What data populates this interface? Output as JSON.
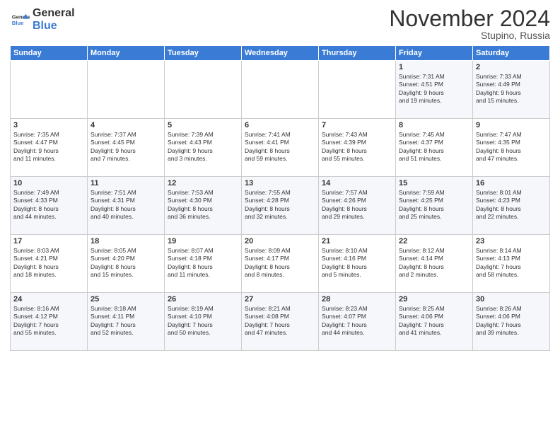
{
  "logo": {
    "line1": "General",
    "line2": "Blue"
  },
  "title": "November 2024",
  "location": "Stupino, Russia",
  "days_header": [
    "Sunday",
    "Monday",
    "Tuesday",
    "Wednesday",
    "Thursday",
    "Friday",
    "Saturday"
  ],
  "weeks": [
    [
      {
        "day": "",
        "info": ""
      },
      {
        "day": "",
        "info": ""
      },
      {
        "day": "",
        "info": ""
      },
      {
        "day": "",
        "info": ""
      },
      {
        "day": "",
        "info": ""
      },
      {
        "day": "1",
        "info": "Sunrise: 7:31 AM\nSunset: 4:51 PM\nDaylight: 9 hours\nand 19 minutes."
      },
      {
        "day": "2",
        "info": "Sunrise: 7:33 AM\nSunset: 4:49 PM\nDaylight: 9 hours\nand 15 minutes."
      }
    ],
    [
      {
        "day": "3",
        "info": "Sunrise: 7:35 AM\nSunset: 4:47 PM\nDaylight: 9 hours\nand 11 minutes."
      },
      {
        "day": "4",
        "info": "Sunrise: 7:37 AM\nSunset: 4:45 PM\nDaylight: 9 hours\nand 7 minutes."
      },
      {
        "day": "5",
        "info": "Sunrise: 7:39 AM\nSunset: 4:43 PM\nDaylight: 9 hours\nand 3 minutes."
      },
      {
        "day": "6",
        "info": "Sunrise: 7:41 AM\nSunset: 4:41 PM\nDaylight: 8 hours\nand 59 minutes."
      },
      {
        "day": "7",
        "info": "Sunrise: 7:43 AM\nSunset: 4:39 PM\nDaylight: 8 hours\nand 55 minutes."
      },
      {
        "day": "8",
        "info": "Sunrise: 7:45 AM\nSunset: 4:37 PM\nDaylight: 8 hours\nand 51 minutes."
      },
      {
        "day": "9",
        "info": "Sunrise: 7:47 AM\nSunset: 4:35 PM\nDaylight: 8 hours\nand 47 minutes."
      }
    ],
    [
      {
        "day": "10",
        "info": "Sunrise: 7:49 AM\nSunset: 4:33 PM\nDaylight: 8 hours\nand 44 minutes."
      },
      {
        "day": "11",
        "info": "Sunrise: 7:51 AM\nSunset: 4:31 PM\nDaylight: 8 hours\nand 40 minutes."
      },
      {
        "day": "12",
        "info": "Sunrise: 7:53 AM\nSunset: 4:30 PM\nDaylight: 8 hours\nand 36 minutes."
      },
      {
        "day": "13",
        "info": "Sunrise: 7:55 AM\nSunset: 4:28 PM\nDaylight: 8 hours\nand 32 minutes."
      },
      {
        "day": "14",
        "info": "Sunrise: 7:57 AM\nSunset: 4:26 PM\nDaylight: 8 hours\nand 29 minutes."
      },
      {
        "day": "15",
        "info": "Sunrise: 7:59 AM\nSunset: 4:25 PM\nDaylight: 8 hours\nand 25 minutes."
      },
      {
        "day": "16",
        "info": "Sunrise: 8:01 AM\nSunset: 4:23 PM\nDaylight: 8 hours\nand 22 minutes."
      }
    ],
    [
      {
        "day": "17",
        "info": "Sunrise: 8:03 AM\nSunset: 4:21 PM\nDaylight: 8 hours\nand 18 minutes."
      },
      {
        "day": "18",
        "info": "Sunrise: 8:05 AM\nSunset: 4:20 PM\nDaylight: 8 hours\nand 15 minutes."
      },
      {
        "day": "19",
        "info": "Sunrise: 8:07 AM\nSunset: 4:18 PM\nDaylight: 8 hours\nand 11 minutes."
      },
      {
        "day": "20",
        "info": "Sunrise: 8:09 AM\nSunset: 4:17 PM\nDaylight: 8 hours\nand 8 minutes."
      },
      {
        "day": "21",
        "info": "Sunrise: 8:10 AM\nSunset: 4:16 PM\nDaylight: 8 hours\nand 5 minutes."
      },
      {
        "day": "22",
        "info": "Sunrise: 8:12 AM\nSunset: 4:14 PM\nDaylight: 8 hours\nand 2 minutes."
      },
      {
        "day": "23",
        "info": "Sunrise: 8:14 AM\nSunset: 4:13 PM\nDaylight: 7 hours\nand 58 minutes."
      }
    ],
    [
      {
        "day": "24",
        "info": "Sunrise: 8:16 AM\nSunset: 4:12 PM\nDaylight: 7 hours\nand 55 minutes."
      },
      {
        "day": "25",
        "info": "Sunrise: 8:18 AM\nSunset: 4:11 PM\nDaylight: 7 hours\nand 52 minutes."
      },
      {
        "day": "26",
        "info": "Sunrise: 8:19 AM\nSunset: 4:10 PM\nDaylight: 7 hours\nand 50 minutes."
      },
      {
        "day": "27",
        "info": "Sunrise: 8:21 AM\nSunset: 4:08 PM\nDaylight: 7 hours\nand 47 minutes."
      },
      {
        "day": "28",
        "info": "Sunrise: 8:23 AM\nSunset: 4:07 PM\nDaylight: 7 hours\nand 44 minutes."
      },
      {
        "day": "29",
        "info": "Sunrise: 8:25 AM\nSunset: 4:06 PM\nDaylight: 7 hours\nand 41 minutes."
      },
      {
        "day": "30",
        "info": "Sunrise: 8:26 AM\nSunset: 4:06 PM\nDaylight: 7 hours\nand 39 minutes."
      }
    ]
  ]
}
